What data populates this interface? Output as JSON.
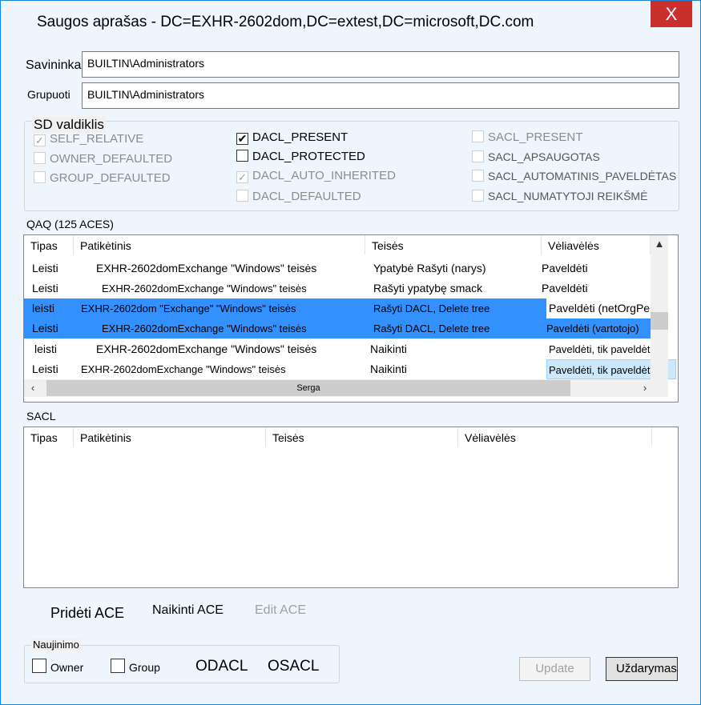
{
  "window": {
    "title": "Saugos aprašas - DC=EXHR-2602dom,DC=extest,DC=microsoft,DC.com",
    "close_glyph": "X"
  },
  "owner": {
    "label": "Savininkas",
    "value": "BUILTIN\\Administrators"
  },
  "group": {
    "label": "Grupuoti",
    "value": "BUILTIN\\Administrators"
  },
  "sd_control": {
    "legend": "SD valdiklis",
    "checkboxes": [
      {
        "label": "SELF_RELATIVE",
        "checked": true,
        "enabled": false
      },
      {
        "label": "OWNER_DEFAULTED",
        "checked": false,
        "enabled": false
      },
      {
        "label": "GROUP_DEFAULTED",
        "checked": false,
        "enabled": false
      },
      {
        "label": "DACL_PRESENT",
        "checked": true,
        "enabled": true
      },
      {
        "label": "DACL_PROTECTED",
        "checked": false,
        "enabled": true
      },
      {
        "label": "DACL_AUTO_INHERITED",
        "checked": true,
        "enabled": false
      },
      {
        "label": "DACL_DEFAULTED",
        "checked": false,
        "enabled": false
      },
      {
        "label": "SACL_PRESENT",
        "checked": false,
        "enabled": false
      },
      {
        "label": "SACL_APSAUGOTAS",
        "checked": false,
        "enabled": false
      },
      {
        "label": "SACL_AUTOMATINIS_PAVELDĖTAS",
        "checked": false,
        "enabled": false
      },
      {
        "label": "SACL_NUMATYTOJI REIKŠMĖ",
        "checked": false,
        "enabled": false
      }
    ]
  },
  "dacl": {
    "label": "QAQ (125 ACES)",
    "columns": [
      "Tipas",
      "Patikėtinis",
      "Teisės",
      "Vėliavėlės"
    ],
    "rows": [
      {
        "type": "Leisti",
        "trustee": "EXHR-2602domExchange \"Windows\" teisės",
        "rights": "Ypatybė Rašyti (narys)",
        "flags": "Paveldėti",
        "selected": false
      },
      {
        "type": "Leisti",
        "trustee": "EXHR-2602domExchange \"Windows\" teisės",
        "rights": "Rašyti ypatybę smack",
        "flags": "Paveldėti",
        "selected": false
      },
      {
        "type": "leisti",
        "trustee": "EXHR-2602dom \"Exchange\" \"Windows\" teisės",
        "rights": "Rašyti DACL, Delete tree",
        "flags": "Paveldėti (netOrgPer",
        "selected": true
      },
      {
        "type": "Leisti",
        "trustee": "EXHR-2602domExchange \"Windows\" teisės",
        "rights": "Rašyti DACL, Delete tree",
        "flags": "Paveldėti (vartotojo)",
        "selected": true
      },
      {
        "type": "leisti",
        "trustee": "EXHR-2602domExchange \"Windows\" teisės",
        "rights": "Naikinti",
        "flags": "Paveldėti, tik paveldėti",
        "selected": false
      },
      {
        "type": "Leisti",
        "trustee": "EXHR-2602domExchange \"Windows\" teisės",
        "rights": "Naikinti",
        "flags": "Paveldėti, tik paveldėti",
        "selected": false
      }
    ],
    "scroll_thumb_label": "Serga"
  },
  "sacl": {
    "label": "SACL",
    "columns": [
      "Tipas",
      "Patikėtinis",
      "Teisės",
      "Vėliavėlės"
    ]
  },
  "actions": {
    "add_ace": "Pridėti ACE",
    "delete_ace": "Naikinti ACE",
    "edit_ace": "Edit ACE"
  },
  "refresh": {
    "legend": "Naujinimo",
    "owner": "Owner",
    "group": "Group",
    "dacl": "ODACL",
    "sacl": "OSACL"
  },
  "buttons": {
    "update": "Update",
    "close": "Uždarymas"
  }
}
